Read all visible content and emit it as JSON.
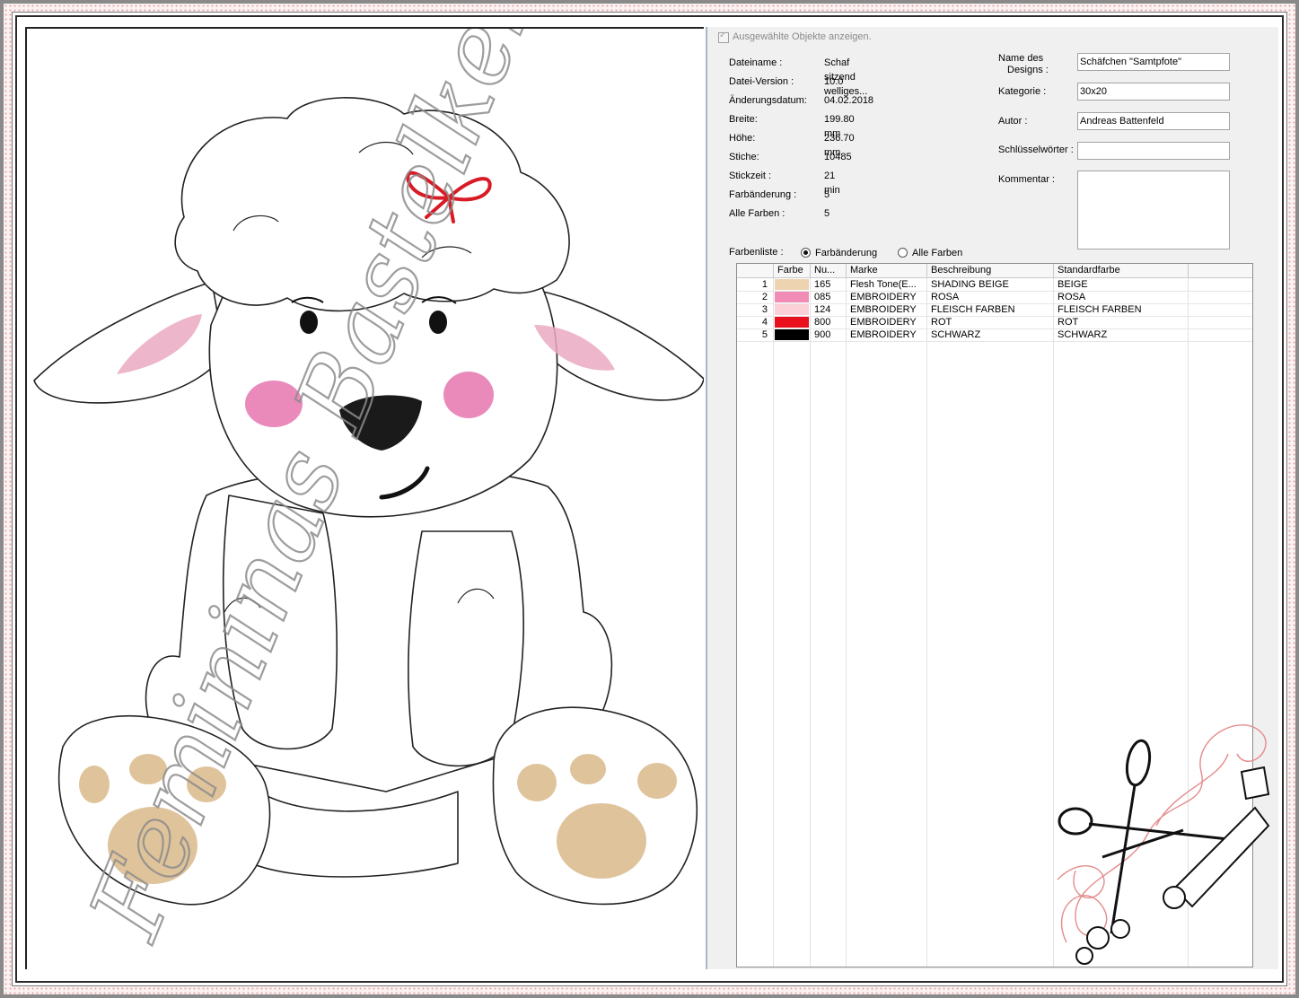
{
  "panel": {
    "show_selected_label": "Ausgewählte Objekte anzeigen.",
    "info": [
      {
        "label": "Dateiname :",
        "value": "Schaf sitzend welliges..."
      },
      {
        "label": "Datei-Version :",
        "value": "10.0"
      },
      {
        "label": "Änderungsdatum:",
        "value": "04.02.2018"
      },
      {
        "label": "Breite:",
        "value": "199.80 mm"
      },
      {
        "label": "Höhe:",
        "value": "236.70 mm"
      },
      {
        "label": "Stiche:",
        "value": "10485"
      },
      {
        "label": "Stickzeit :",
        "value": "21 min"
      },
      {
        "label": "Farbänderung :",
        "value": "5"
      },
      {
        "label": "Alle Farben :",
        "value": "5"
      }
    ],
    "design_name_label_1": "Name des",
    "design_name_label_2": "Designs :",
    "design_name_value": "Schäfchen \"Samtpfote\"",
    "category_label": "Kategorie :",
    "category_value": "30x20",
    "author_label": "Autor :",
    "author_value": "Andreas Battenfeld",
    "keywords_label": "Schlüsselwörter :",
    "keywords_value": "",
    "comment_label": "Kommentar :",
    "comment_value": "",
    "colorlist_label": "Farbenliste :",
    "radio_color_change": "Farbänderung",
    "radio_all_colors": "Alle Farben",
    "radio_selected": "Farbänderung"
  },
  "table": {
    "headers": [
      "",
      "Farbe",
      "Nu...",
      "Marke",
      "Beschreibung",
      "Standardfarbe"
    ],
    "rows": [
      {
        "index": "1",
        "color": "#edd3b0",
        "number": "165",
        "brand": "Flesh Tone(E...",
        "description": "SHADING BEIGE",
        "standard": "BEIGE"
      },
      {
        "index": "2",
        "color": "#f08cb6",
        "number": "085",
        "brand": "EMBROIDERY",
        "description": "ROSA",
        "standard": "ROSA"
      },
      {
        "index": "3",
        "color": "#fbd0d6",
        "number": "124",
        "brand": "EMBROIDERY",
        "description": "FLEISCH FARBEN",
        "standard": "FLEISCH FARBEN"
      },
      {
        "index": "4",
        "color": "#e8101c",
        "number": "800",
        "brand": "EMBROIDERY",
        "description": "ROT",
        "standard": "ROT"
      },
      {
        "index": "5",
        "color": "#000000",
        "number": "900",
        "brand": "EMBROIDERY",
        "description": "SCHWARZ",
        "standard": "SCHWARZ"
      }
    ]
  },
  "watermark": "Femininas Bastelkellerei",
  "colors": {
    "panel_bg": "#f0f0f0",
    "frame_dots": "#e8a6a6",
    "bow": "#d81b25",
    "cheek": "#e98abb",
    "ear_inner": "#eaa9c2",
    "paw_pad": "#dfc39b"
  },
  "icons": [
    "sheep-embroidery-preview",
    "sewing-scissors-tape-logo"
  ]
}
